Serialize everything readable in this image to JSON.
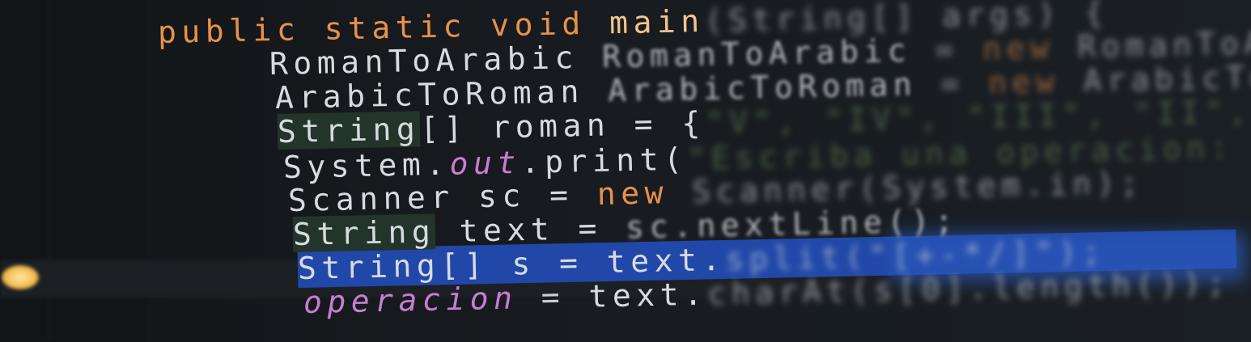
{
  "editor": {
    "lines": [
      {
        "tokens": [
          {
            "t": "public static void ",
            "c": "kw"
          },
          {
            "t": "main",
            "c": "fn"
          },
          {
            "t": "(String[] args) {",
            "c": "id b2"
          }
        ]
      },
      {
        "tokens": [
          {
            "t": "RomanToArabic ",
            "c": "id"
          },
          {
            "t": "RomanToArabic",
            "c": "id b1"
          },
          {
            "t": " = ",
            "c": "pu b2"
          },
          {
            "t": "new ",
            "c": "kw b2"
          },
          {
            "t": "RomanToArabic();",
            "c": "id b2"
          }
        ]
      },
      {
        "tokens": [
          {
            "t": "ArabicToRoman ",
            "c": "id"
          },
          {
            "t": "ArabicToRoman",
            "c": "id b1"
          },
          {
            "t": " = ",
            "c": "pu b2"
          },
          {
            "t": "new ",
            "c": "kw b2"
          },
          {
            "t": "ArabicToRoman();",
            "c": "id b2"
          }
        ]
      },
      {
        "tokens": [
          {
            "t": "String",
            "c": "id hl"
          },
          {
            "t": "[] roman = {",
            "c": "id"
          },
          {
            "t": "\"V\", \"IV\", \"III\", \"II\", \"I\"",
            "c": "str b2"
          }
        ]
      },
      {
        "tokens": [
          {
            "t": "System.",
            "c": "id"
          },
          {
            "t": "out",
            "c": "fld"
          },
          {
            "t": ".print(",
            "c": "id"
          },
          {
            "t": "\"Escriba una operacion: \");",
            "c": "str b2"
          }
        ]
      },
      {
        "tokens": [
          {
            "t": "Scanner sc = ",
            "c": "id"
          },
          {
            "t": "new ",
            "c": "kw"
          },
          {
            "t": "Scanner(System.in);",
            "c": "id b2"
          }
        ]
      },
      {
        "tokens": [
          {
            "t": "String",
            "c": "id hl"
          },
          {
            "t": " text = ",
            "c": "id"
          },
          {
            "t": "sc.nextLine();",
            "c": "id b1"
          }
        ]
      },
      {
        "tokens": [
          {
            "t": "String[] s = ",
            "c": "id"
          },
          {
            "t": "text.",
            "c": "id"
          },
          {
            "t": "split(\"[+-*/]\");",
            "c": "id b2"
          }
        ]
      },
      {
        "tokens": [
          {
            "t": "operacion",
            "c": "fld"
          },
          {
            "t": " = ",
            "c": "pu"
          },
          {
            "t": "text.",
            "c": "id"
          },
          {
            "t": "charAt(s[0].length());",
            "c": "id b2"
          }
        ]
      }
    ]
  }
}
